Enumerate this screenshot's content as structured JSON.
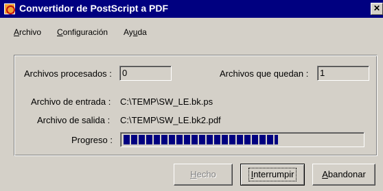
{
  "window": {
    "title": "Convertidor de PostScript a PDF",
    "close_glyph": "✕"
  },
  "menu": {
    "items": [
      {
        "underline": "A",
        "rest": "rchivo"
      },
      {
        "underline": "C",
        "rest": "onfiguración"
      },
      {
        "pre": "Ay",
        "underline": "u",
        "rest": "da"
      }
    ]
  },
  "stats": {
    "processed_label": "Archivos procesados :",
    "processed_value": "0",
    "remaining_label": "Archivos que quedan :",
    "remaining_value": "1"
  },
  "files": {
    "input_label": "Archivo de entrada :",
    "input_value": "C:\\TEMP\\SW_LE.bk.ps",
    "output_label": "Archivo de salida :",
    "output_value": "C:\\TEMP\\SW_LE.bk2.pdf"
  },
  "progress": {
    "label": "Progreso :",
    "fraction": 0.65
  },
  "buttons": {
    "done": {
      "underline": "H",
      "rest": "echo"
    },
    "interrupt": {
      "underline": "I",
      "rest": "nterrumpir"
    },
    "abandon": {
      "underline": "A",
      "rest": "bandonar"
    }
  },
  "colors": {
    "titlebar": "#000080",
    "face": "#d4d0c8",
    "progress": "#000080"
  }
}
